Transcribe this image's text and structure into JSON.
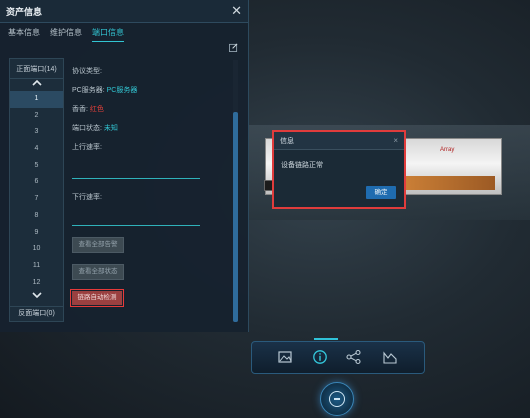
{
  "panel": {
    "title": "资产信息",
    "tabs": [
      "基本信息",
      "维护信息",
      "端口信息"
    ],
    "active_tab": 2
  },
  "ports": {
    "front_header": "正面端口(14)",
    "numbers": [
      "1",
      "2",
      "3",
      "4",
      "5",
      "6",
      "7",
      "8",
      "9",
      "10",
      "11",
      "12"
    ],
    "active_index": 0,
    "back_footer": "反面端口(0)"
  },
  "details": {
    "protocol_label": "协议类型:",
    "pc_server_label": "PC服务器:",
    "pc_server_value": "PC服务器",
    "color_label": "香香:",
    "color_value": "红色",
    "port_status_label": "端口状态:",
    "port_status_value": "未知",
    "upstream_label": "上行速率:",
    "downstream_label": "下行速率:"
  },
  "buttons": {
    "view_all_alarms": "查看全部告警",
    "view_all_status": "查看全部状态",
    "link_auto_detect": "链路自动检测"
  },
  "dialog": {
    "title": "信息",
    "message": "设备链路正常",
    "confirm": "确定",
    "close": "×"
  },
  "device": {
    "logo": "Array"
  },
  "toolbar": {
    "icons": [
      "image-icon",
      "info-icon",
      "topology-icon",
      "chart-icon"
    ],
    "active_index": 1
  },
  "colors": {
    "accent": "#32c5d2",
    "highlight": "#e03c3c",
    "primary_button": "#1f6cb0"
  }
}
